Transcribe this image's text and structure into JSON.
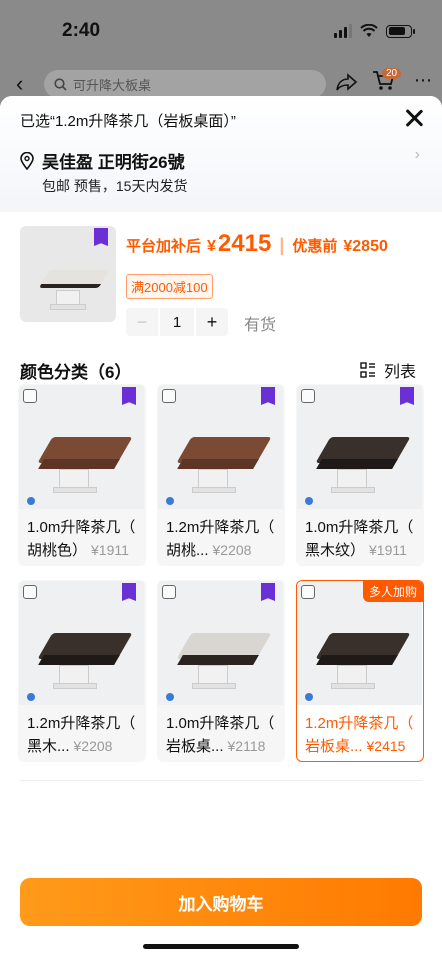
{
  "status_bar": {
    "time": "2:40"
  },
  "background_nav": {
    "search_placeholder": "可升降大板桌",
    "cart_badge": "20"
  },
  "sheet": {
    "selected_title": "已选“1.2m升降茶几（岩板桌面）”",
    "address": "吴佳盈 正明街26號",
    "shipping": "包邮 预售，15天内发货"
  },
  "product": {
    "price_label": "平台加补后",
    "currency": "¥",
    "price": "2415",
    "orig_label": "优惠前",
    "orig_price": "¥2850",
    "promo": "满2000减100",
    "quantity": "1",
    "minus": "−",
    "plus": "+",
    "stock": "有货"
  },
  "options": {
    "title": "颜色分类（6）",
    "list_label": "列表",
    "items": [
      {
        "line1": "1.0m升降茶几（",
        "line2": "胡桃色）",
        "price": "¥1911"
      },
      {
        "line1": "1.2m升降茶几（",
        "line2": "胡桃...",
        "price": "¥2208"
      },
      {
        "line1": "1.0m升降茶几（",
        "line2": "黑木纹）",
        "price": "¥1911"
      },
      {
        "line1": "1.2m升降茶几（",
        "line2": "黑木...",
        "price": "¥2208"
      },
      {
        "line1": "1.0m升降茶几（",
        "line2": "岩板桌...",
        "price": "¥2118"
      },
      {
        "line1": "1.2m升降茶几（",
        "line2": "岩板桌...",
        "price": "¥2415",
        "tag": "多人加购"
      }
    ]
  },
  "cta_label": "加入购物车",
  "colors": {
    "accent": "#ff5a00",
    "cta_start": "#ff9a1a",
    "cta_end": "#ff7a00"
  }
}
